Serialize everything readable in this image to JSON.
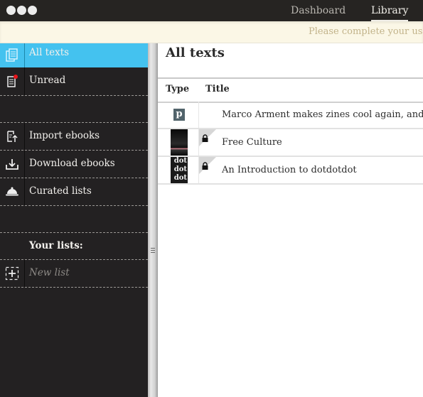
{
  "window": {
    "controls": [
      "close",
      "minimize",
      "maximize"
    ]
  },
  "nav": {
    "items": [
      {
        "label": "Dashboard",
        "active": false
      },
      {
        "label": "Library",
        "active": true
      }
    ]
  },
  "notice": {
    "text": "Please complete your user"
  },
  "sidebar": {
    "items": [
      {
        "label": "All texts",
        "icon": "documents-icon",
        "active": true
      },
      {
        "label": "Unread",
        "icon": "unread-document-icon",
        "badge_color": "#e8151b"
      },
      {
        "label": "Import ebooks",
        "icon": "import-icon"
      },
      {
        "label": "Download ebooks",
        "icon": "download-icon"
      },
      {
        "label": "Curated lists",
        "icon": "cloche-icon"
      }
    ],
    "your_lists_heading": "Your lists:",
    "new_list": {
      "label": "New list",
      "icon": "add-list-icon"
    }
  },
  "main": {
    "title": "All texts",
    "columns": [
      "Type",
      "Title"
    ],
    "rows": [
      {
        "type": "pocket",
        "type_glyph": "p",
        "title": "Marco Arment makes zines cool again, and po",
        "locked": false
      },
      {
        "type": "ebook-cover",
        "title": "Free Culture",
        "locked": true
      },
      {
        "type": "ebook-cover",
        "cover_text": "dot dot dot",
        "title": "An Introduction to dotdotdot",
        "locked": true
      }
    ]
  },
  "colors": {
    "accent": "#44c2ef",
    "sidebar_bg": "#232122",
    "topbar_bg": "#262422",
    "notice_bg": "#fbf7e6"
  }
}
